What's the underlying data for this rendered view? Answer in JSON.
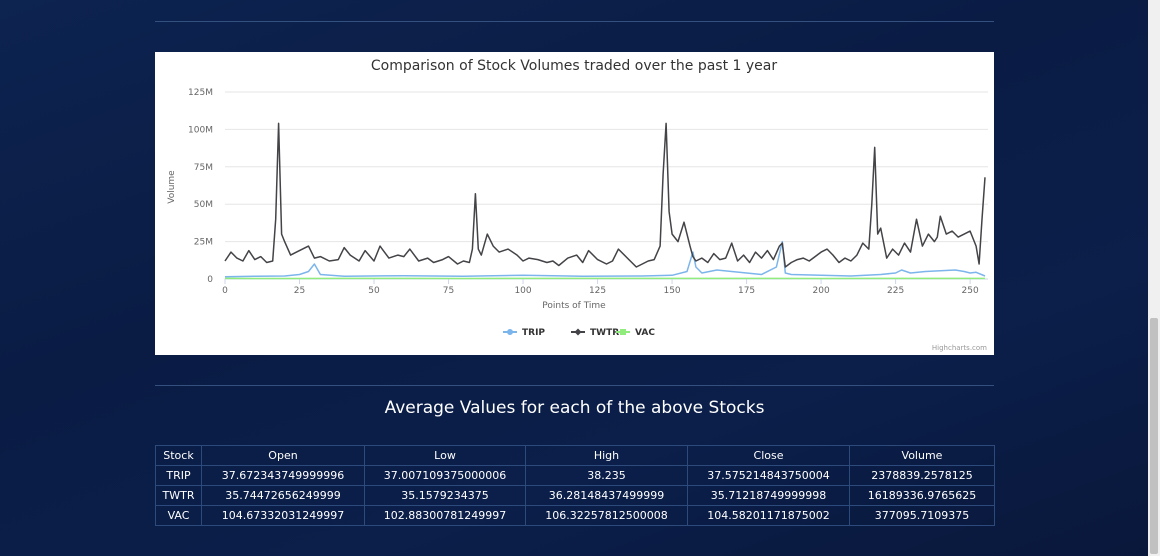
{
  "chart_data": {
    "type": "line",
    "title": "Comparison of Stock Volumes traded over the past 1 year",
    "xlabel": "Points of Time",
    "ylabel": "Volume",
    "xlim": [
      0,
      256
    ],
    "ylim": [
      0,
      125000000
    ],
    "x_ticks": [
      0,
      25,
      50,
      75,
      100,
      125,
      150,
      175,
      200,
      225,
      250
    ],
    "x_tick_labels": [
      "0",
      "25",
      "50",
      "75",
      "100",
      "125",
      "150",
      "175",
      "200",
      "225",
      "250"
    ],
    "y_ticks": [
      0,
      25000000,
      50000000,
      75000000,
      100000000,
      125000000
    ],
    "y_tick_labels": [
      "0",
      "25M",
      "50M",
      "75M",
      "100M",
      "125M"
    ],
    "grid": true,
    "legend_position": "bottom-center",
    "series": [
      {
        "name": "TRIP",
        "color": "#7cb5ec",
        "x": [
          0,
          10,
          20,
          25,
          28,
          30,
          32,
          40,
          60,
          80,
          100,
          120,
          140,
          150,
          155,
          157,
          158,
          160,
          165,
          170,
          175,
          180,
          185,
          187,
          188,
          190,
          200,
          210,
          220,
          225,
          227,
          230,
          235,
          240,
          245,
          248,
          250,
          252,
          255
        ],
        "values": [
          1500000,
          1800000,
          2000000,
          3000000,
          5000000,
          10000000,
          3000000,
          1800000,
          2200000,
          1900000,
          2500000,
          1800000,
          2000000,
          2500000,
          5000000,
          18000000,
          8000000,
          4000000,
          6000000,
          5000000,
          4000000,
          3000000,
          8000000,
          25000000,
          4000000,
          3000000,
          2500000,
          2000000,
          3000000,
          4000000,
          6000000,
          4000000,
          5000000,
          5500000,
          6000000,
          5000000,
          4000000,
          4500000,
          2000000
        ]
      },
      {
        "name": "TWTR",
        "color": "#434348",
        "x": [
          0,
          2,
          4,
          6,
          8,
          10,
          12,
          14,
          16,
          17,
          18,
          19,
          20,
          22,
          24,
          26,
          28,
          30,
          32,
          35,
          38,
          40,
          42,
          45,
          47,
          50,
          52,
          55,
          58,
          60,
          62,
          65,
          68,
          70,
          73,
          75,
          78,
          80,
          82,
          83,
          84,
          85,
          86,
          88,
          90,
          92,
          95,
          98,
          100,
          102,
          105,
          108,
          110,
          112,
          115,
          118,
          120,
          122,
          125,
          128,
          130,
          132,
          135,
          138,
          140,
          142,
          144,
          146,
          147,
          148,
          149,
          150,
          152,
          154,
          156,
          157,
          158,
          160,
          162,
          164,
          166,
          168,
          170,
          172,
          174,
          176,
          178,
          180,
          182,
          184,
          186,
          187,
          188,
          190,
          192,
          194,
          196,
          198,
          200,
          202,
          204,
          206,
          208,
          210,
          212,
          214,
          216,
          217,
          218,
          219,
          220,
          222,
          224,
          226,
          228,
          230,
          232,
          234,
          236,
          238,
          239,
          240,
          242,
          244,
          246,
          248,
          250,
          252,
          253,
          254,
          255
        ],
        "values": [
          12000000,
          18000000,
          14000000,
          12000000,
          19000000,
          13000000,
          15000000,
          11000000,
          12000000,
          40000000,
          104000000,
          30000000,
          25000000,
          16000000,
          18000000,
          20000000,
          22000000,
          14000000,
          15000000,
          12000000,
          13000000,
          21000000,
          16000000,
          12000000,
          19000000,
          12000000,
          22000000,
          14000000,
          16000000,
          15000000,
          20000000,
          12000000,
          14000000,
          11000000,
          13000000,
          15000000,
          10000000,
          12000000,
          11000000,
          20000000,
          57000000,
          20000000,
          16000000,
          30000000,
          22000000,
          18000000,
          20000000,
          16000000,
          12000000,
          14000000,
          13000000,
          11000000,
          12000000,
          9000000,
          14000000,
          16000000,
          11000000,
          19000000,
          13000000,
          10000000,
          12000000,
          20000000,
          14000000,
          8000000,
          10000000,
          12000000,
          13000000,
          22000000,
          70000000,
          104000000,
          45000000,
          30000000,
          25000000,
          38000000,
          22000000,
          15000000,
          12000000,
          14000000,
          11000000,
          17000000,
          13000000,
          14000000,
          24000000,
          12000000,
          16000000,
          11000000,
          18000000,
          14000000,
          19000000,
          13000000,
          22000000,
          24000000,
          8000000,
          11000000,
          13000000,
          14000000,
          12000000,
          15000000,
          18000000,
          20000000,
          16000000,
          11000000,
          14000000,
          12000000,
          16000000,
          24000000,
          20000000,
          50000000,
          88000000,
          30000000,
          34000000,
          14000000,
          20000000,
          16000000,
          24000000,
          18000000,
          40000000,
          22000000,
          30000000,
          25000000,
          28000000,
          42000000,
          30000000,
          32000000,
          28000000,
          30000000,
          32000000,
          22000000,
          10000000,
          40000000,
          68000000
        ]
      },
      {
        "name": "VAC",
        "color": "#90ed7d",
        "x": [
          0,
          20,
          40,
          60,
          80,
          100,
          120,
          140,
          160,
          180,
          200,
          220,
          240,
          255
        ],
        "values": [
          400000,
          350000,
          380000,
          420000,
          360000,
          400000,
          370000,
          390000,
          410000,
          380000,
          360000,
          400000,
          390000,
          370000
        ]
      }
    ],
    "credits": "Highcharts.com"
  },
  "avg_table": {
    "heading": "Average Values for each of the above Stocks",
    "headers": [
      "Stock",
      "Open",
      "Low",
      "High",
      "Close",
      "Volume"
    ],
    "rows": [
      [
        "TRIP",
        "37.672343749999996",
        "37.007109375000006",
        "38.235",
        "37.575214843750004",
        "2378839.2578125"
      ],
      [
        "TWTR",
        "35.74472656249999",
        "35.1579234375",
        "36.28148437499999",
        "35.71218749999998",
        "16189336.9765625"
      ],
      [
        "VAC",
        "104.67332031249997",
        "102.88300781249997",
        "106.32257812500008",
        "104.58201171875002",
        "377095.7109375"
      ]
    ]
  }
}
